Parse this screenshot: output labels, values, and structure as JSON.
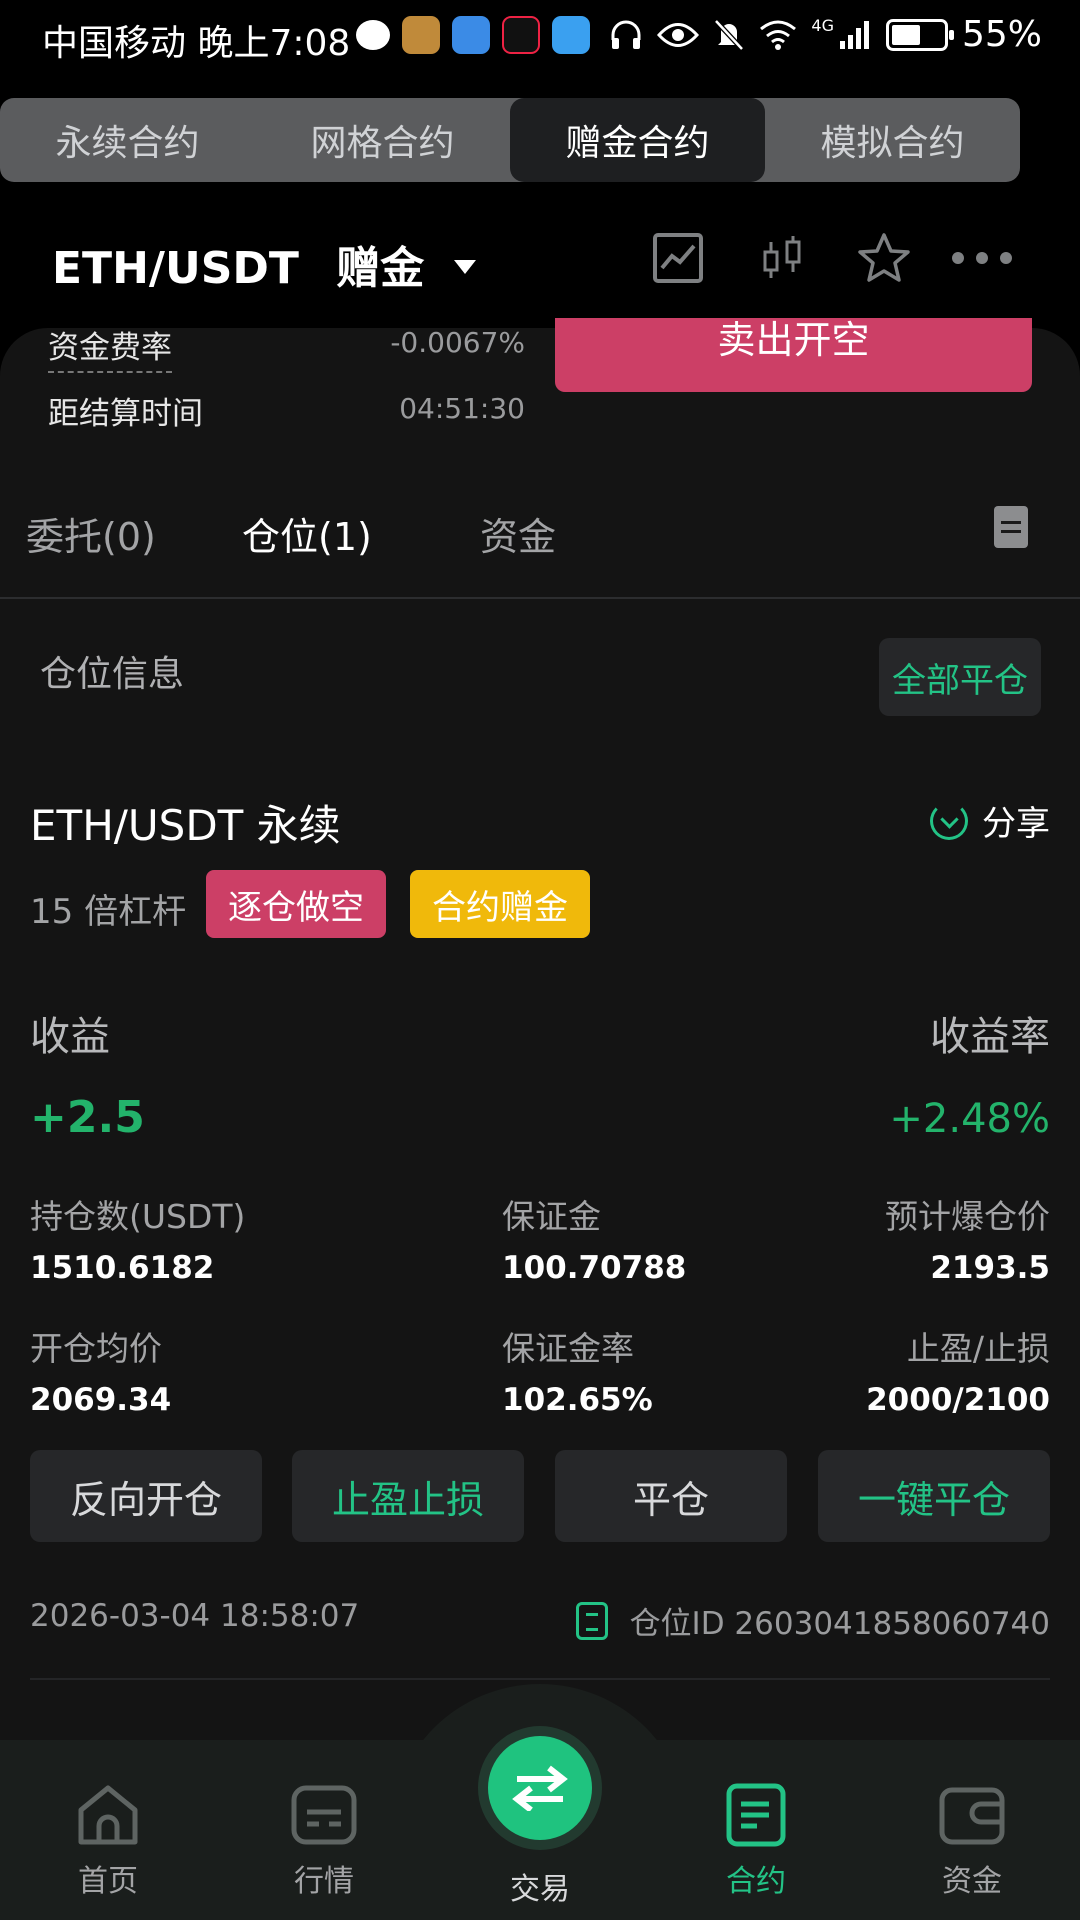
{
  "status_bar": {
    "carrier_time": "中国移动 晚上7:08",
    "network": "4G",
    "battery": "55%"
  },
  "top_tabs": [
    {
      "label": "永续合约",
      "active": false
    },
    {
      "label": "网格合约",
      "active": false
    },
    {
      "label": "赠金合约",
      "active": true
    },
    {
      "label": "模拟合约",
      "active": false
    }
  ],
  "header": {
    "pair": "ETH/USDT",
    "mode": "赠金"
  },
  "funding": {
    "rate_label": "资金费率",
    "rate_value": "-0.0067%",
    "settle_label": "距结算时间",
    "settle_value": "04:51:30"
  },
  "sell_button": "卖出开空",
  "sub_tabs": [
    "委托(0)",
    "仓位(1)",
    "资金"
  ],
  "position_section": {
    "title": "仓位信息",
    "close_all": "全部平仓"
  },
  "position": {
    "name": "ETH/USDT 永续",
    "share": "分享",
    "leverage": "15 倍杠杆",
    "tag_direction": "逐仓做空",
    "tag_bonus": "合约赠金",
    "pnl_label": "收益",
    "pnl_value": "+2.5",
    "pnl_rate_label": "收益率",
    "pnl_rate_value": "+2.48%",
    "stats": [
      {
        "label": "持仓数(USDT)",
        "value": "1510.6182"
      },
      {
        "label": "保证金",
        "value": "100.70788"
      },
      {
        "label": "预计爆仓价",
        "value": "2193.5"
      },
      {
        "label": "开仓均价",
        "value": "2069.34"
      },
      {
        "label": "保证金率",
        "value": "102.65%"
      },
      {
        "label": "止盈/止损",
        "value": "2000/2100"
      }
    ],
    "actions": [
      "反向开仓",
      "止盈止损",
      "平仓",
      "一键平仓"
    ],
    "time": "2026-03-04 18:58:07",
    "id_text": "仓位ID 2603041858060740"
  },
  "bottom_nav": [
    {
      "label": "首页",
      "icon": "home-icon"
    },
    {
      "label": "行情",
      "icon": "market-icon"
    },
    {
      "label": "交易",
      "icon": "swap-icon"
    },
    {
      "label": "合约",
      "icon": "contract-icon",
      "active": true
    },
    {
      "label": "资金",
      "icon": "wallet-icon"
    }
  ],
  "colors": {
    "green": "#23c386",
    "red": "#cc3f66",
    "yellow": "#f0b90b"
  }
}
